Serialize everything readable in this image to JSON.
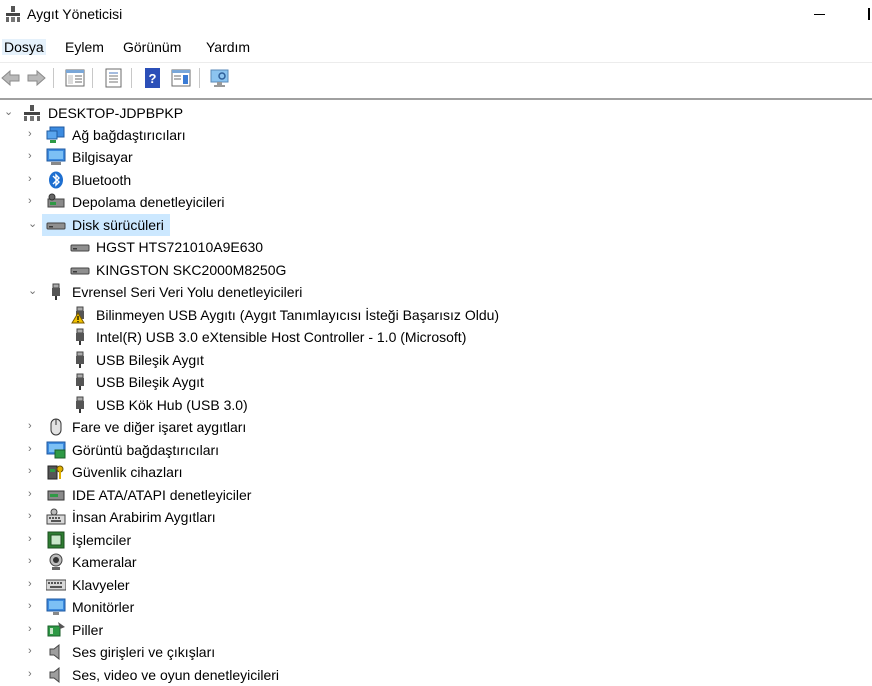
{
  "window": {
    "title": "Aygıt Yöneticisi"
  },
  "menu": {
    "items": [
      "Dosya",
      "Eylem",
      "Görünüm",
      "Yardım"
    ]
  },
  "tree": {
    "root": "DESKTOP-JDPBPKP",
    "categories": [
      {
        "label": "Ağ bağdaştırıcıları",
        "icon": "network-adapter-icon",
        "expanded": false
      },
      {
        "label": "Bilgisayar",
        "icon": "computer-icon",
        "expanded": false
      },
      {
        "label": "Bluetooth",
        "icon": "bluetooth-icon",
        "expanded": false
      },
      {
        "label": "Depolama denetleyicileri",
        "icon": "storage-controller-icon",
        "expanded": false
      },
      {
        "label": "Disk sürücüleri",
        "icon": "disk-drive-icon",
        "expanded": true,
        "selected": true,
        "children": [
          {
            "label": "HGST HTS721010A9E630",
            "icon": "disk-drive-icon"
          },
          {
            "label": "KINGSTON SKC2000M8250G",
            "icon": "disk-drive-icon"
          }
        ]
      },
      {
        "label": "Evrensel Seri Veri Yolu denetleyicileri",
        "icon": "usb-plug-icon",
        "expanded": true,
        "children": [
          {
            "label": "Bilinmeyen USB Aygıtı (Aygıt Tanımlayıcısı İsteği Başarısız Oldu)",
            "icon": "usb-warning-icon"
          },
          {
            "label": "Intel(R) USB 3.0 eXtensible Host Controller - 1.0 (Microsoft)",
            "icon": "usb-plug-icon"
          },
          {
            "label": "USB Bileşik Aygıt",
            "icon": "usb-plug-icon"
          },
          {
            "label": "USB Bileşik Aygıt",
            "icon": "usb-plug-icon"
          },
          {
            "label": "USB Kök Hub (USB 3.0)",
            "icon": "usb-plug-icon"
          }
        ]
      },
      {
        "label": "Fare ve diğer işaret aygıtları",
        "icon": "mouse-icon",
        "expanded": false
      },
      {
        "label": "Görüntü bağdaştırıcıları",
        "icon": "display-adapter-icon",
        "expanded": false
      },
      {
        "label": "Güvenlik cihazları",
        "icon": "security-device-icon",
        "expanded": false
      },
      {
        "label": "IDE ATA/ATAPI denetleyiciler",
        "icon": "ide-controller-icon",
        "expanded": false
      },
      {
        "label": "İnsan Arabirim Aygıtları",
        "icon": "hid-icon",
        "expanded": false
      },
      {
        "label": "İşlemciler",
        "icon": "processor-icon",
        "expanded": false
      },
      {
        "label": "Kameralar",
        "icon": "camera-icon",
        "expanded": false
      },
      {
        "label": "Klavyeler",
        "icon": "keyboard-icon",
        "expanded": false
      },
      {
        "label": "Monitörler",
        "icon": "monitor-icon",
        "expanded": false
      },
      {
        "label": "Piller",
        "icon": "battery-icon",
        "expanded": false
      },
      {
        "label": "Ses girişleri ve çıkışları",
        "icon": "speaker-icon",
        "expanded": false
      },
      {
        "label": "Ses, video ve oyun denetleyicileri",
        "icon": "sound-controller-icon",
        "expanded": false
      }
    ]
  },
  "colors": {
    "selection": "#cce8ff",
    "accent": "#0078d7"
  }
}
